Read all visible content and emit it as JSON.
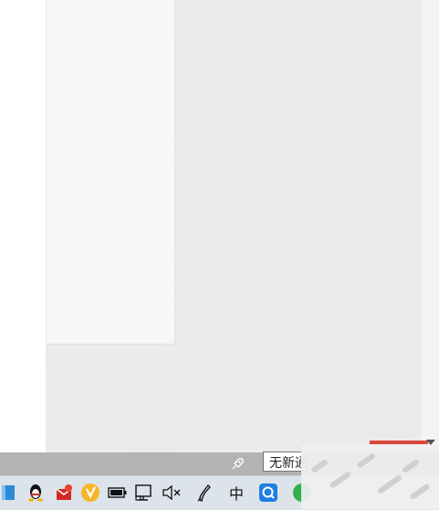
{
  "notification": {
    "tooltip_text": "无新通知"
  },
  "taskbar": {
    "tray_icons": [
      "store-icon",
      "qq-icon",
      "mail-icon",
      "browser-icon",
      "battery-icon",
      "network-icon",
      "volume-muted-icon",
      "pen-icon",
      "ime-icon",
      "search-app-icon",
      "wechat-icon"
    ],
    "ime_label": "中"
  },
  "colors": {
    "accent_red": "#d9473d",
    "taskbar_bg": "#dde3ea",
    "notify_bar_bg": "#b3b3b3"
  }
}
